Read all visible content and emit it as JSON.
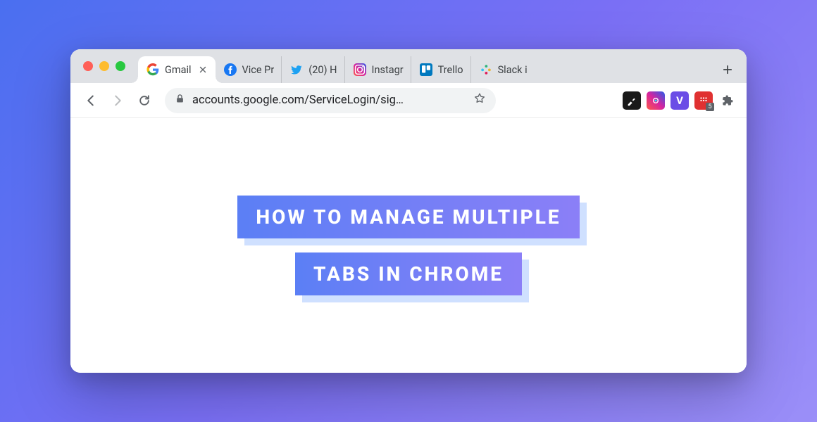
{
  "tabs": [
    {
      "label": "Gmail",
      "icon": "google",
      "active": true
    },
    {
      "label": "Vice Pr",
      "icon": "facebook",
      "active": false
    },
    {
      "label": "(20) H",
      "icon": "twitter",
      "active": false
    },
    {
      "label": "Instagr",
      "icon": "instagram",
      "active": false
    },
    {
      "label": "Trello",
      "icon": "trello",
      "active": false
    },
    {
      "label": "Slack i",
      "icon": "slack",
      "active": false
    }
  ],
  "omnibox": {
    "url": "accounts.google.com/ServiceLogin/sig…"
  },
  "extensions": [
    {
      "name": "eyedropper",
      "style": "dark"
    },
    {
      "name": "camera",
      "style": "ig"
    },
    {
      "name": "v-ext",
      "style": "purple",
      "letter": "V"
    },
    {
      "name": "grid-ext",
      "style": "red",
      "badge": "5"
    },
    {
      "name": "extensions-menu",
      "style": "puzzle"
    }
  ],
  "headline": {
    "line1": "HOW TO MANAGE MULTIPLE",
    "line2": "TABS IN CHROME"
  }
}
